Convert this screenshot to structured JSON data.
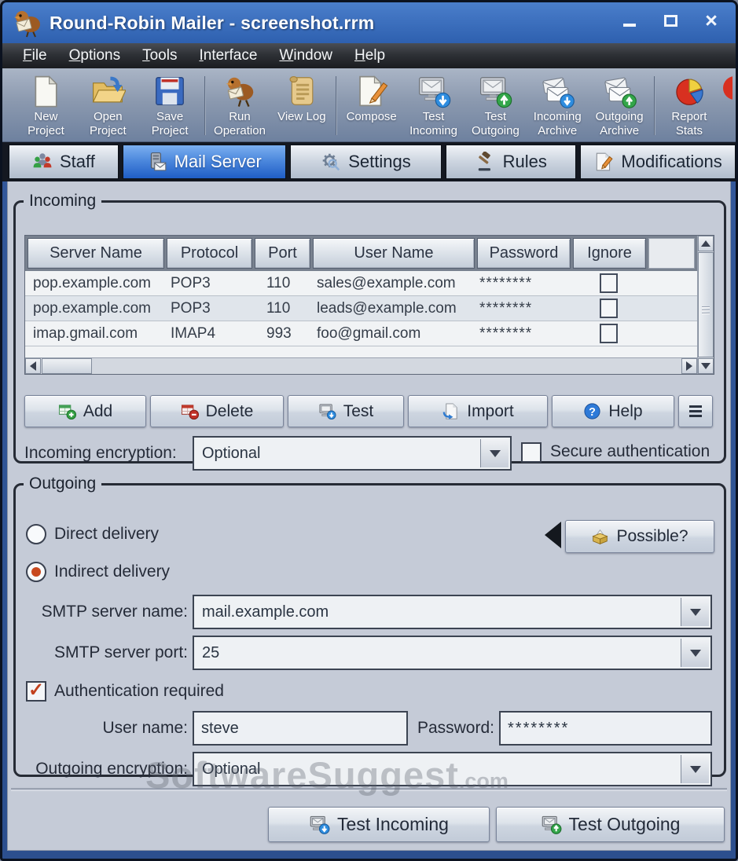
{
  "window": {
    "title": "Round-Robin Mailer - screenshot.rrm"
  },
  "colors": {
    "titlebar_blue": "#3b6fbe",
    "selected_tab_blue": "#4a86dc",
    "check_accent": "#c2401c",
    "content_background": "#c5cbd7"
  },
  "menu": {
    "items": [
      {
        "label": "File"
      },
      {
        "label": "Options"
      },
      {
        "label": "Tools"
      },
      {
        "label": "Interface"
      },
      {
        "label": "Window"
      },
      {
        "label": "Help"
      }
    ]
  },
  "toolbar": {
    "items": [
      {
        "label": "New Project",
        "icon": "new-project-icon"
      },
      {
        "label": "Open Project",
        "icon": "open-project-icon"
      },
      {
        "label": "Save Project",
        "icon": "save-project-icon"
      },
      {
        "label": "Run Operation",
        "icon": "run-operation-icon"
      },
      {
        "label": "View Log",
        "icon": "view-log-icon"
      },
      {
        "label": "Compose",
        "icon": "compose-icon"
      },
      {
        "label": "Test Incoming",
        "icon": "test-incoming-icon"
      },
      {
        "label": "Test Outgoing",
        "icon": "test-outgoing-icon"
      },
      {
        "label": "Incoming Archive",
        "icon": "incoming-archive-icon"
      },
      {
        "label": "Outgoing Archive",
        "icon": "outgoing-archive-icon"
      },
      {
        "label": "Report Stats",
        "icon": "report-stats-icon"
      }
    ]
  },
  "tabs": {
    "items": [
      {
        "label": "Staff",
        "icon": "staff-icon",
        "selected": false
      },
      {
        "label": "Mail Server",
        "icon": "mail-server-icon",
        "selected": true
      },
      {
        "label": "Settings",
        "icon": "settings-icon",
        "selected": false
      },
      {
        "label": "Rules",
        "icon": "rules-icon",
        "selected": false
      },
      {
        "label": "Modifications",
        "icon": "modifications-icon",
        "selected": false
      }
    ]
  },
  "incoming": {
    "legend": "Incoming",
    "table": {
      "columns": [
        "Server Name",
        "Protocol",
        "Port",
        "User Name",
        "Password",
        "Ignore"
      ],
      "rows": [
        {
          "server": "pop.example.com",
          "protocol": "POP3",
          "port": "110",
          "user": "sales@example.com",
          "password": "********",
          "ignore": false
        },
        {
          "server": "pop.example.com",
          "protocol": "POP3",
          "port": "110",
          "user": "leads@example.com",
          "password": "********",
          "ignore": false
        },
        {
          "server": "imap.gmail.com",
          "protocol": "IMAP4",
          "port": "993",
          "user": "foo@gmail.com",
          "password": "********",
          "ignore": false
        }
      ]
    },
    "buttons": {
      "add": "Add",
      "delete": "Delete",
      "test": "Test",
      "import": "Import",
      "help": "Help"
    },
    "encryption_label": "Incoming encryption:",
    "encryption_value": "Optional",
    "secure_auth_label": "Secure authentication",
    "secure_auth_checked": false
  },
  "outgoing": {
    "legend": "Outgoing",
    "direct_label": "Direct delivery",
    "direct_checked": false,
    "indirect_label": "Indirect delivery",
    "indirect_checked": true,
    "possible_button": "Possible?",
    "smtp_name_label": "SMTP server name:",
    "smtp_name_value": "mail.example.com",
    "smtp_port_label": "SMTP server port:",
    "smtp_port_value": "25",
    "auth_label": "Authentication required",
    "auth_checked": true,
    "user_label": "User name:",
    "user_value": "steve",
    "password_label": "Password:",
    "password_value": "********",
    "encryption_label": "Outgoing encryption:",
    "encryption_value": "Optional"
  },
  "footer": {
    "test_incoming": "Test Incoming",
    "test_outgoing": "Test Outgoing"
  },
  "watermark": {
    "main": "SoftwareSuggest",
    "suffix": ".com"
  }
}
